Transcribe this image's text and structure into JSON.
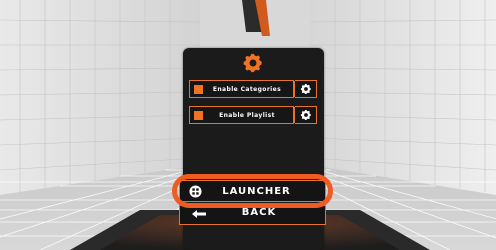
{
  "scene": {
    "colors": {
      "accent": "#f07324",
      "highlight_ring": "#ef5b22",
      "panel": "#1b1b1b",
      "floor_grid": "#ffffff",
      "room": "#dcdcdc"
    }
  },
  "settings_panel": {
    "header_icon": "gear-icon",
    "toggles": [
      {
        "label": "Enable Categories",
        "checked": true,
        "settings_icon": "gear-icon"
      },
      {
        "label": "Enable Playlist",
        "checked": true,
        "settings_icon": "gear-icon"
      }
    ]
  },
  "buttons": {
    "launcher_label": "LAUNCHER",
    "launcher_icon": "launcher-grid-icon",
    "back_label": "BACK",
    "back_icon": "back-arrow-icon"
  }
}
